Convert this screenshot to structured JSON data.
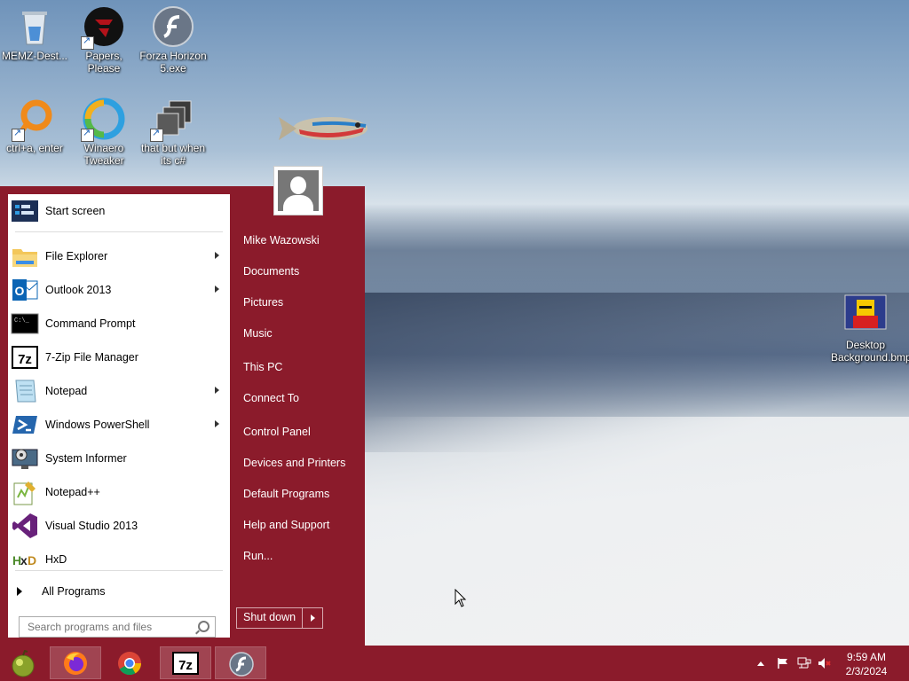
{
  "desktop": {
    "icons": [
      {
        "label": "MEMZ-Dest...",
        "icon": "recycle-bin-icon"
      },
      {
        "label": "Papers, Please",
        "icon": "papers-please-icon"
      },
      {
        "label": "Forza Horizon 5.exe",
        "icon": "flash-icon"
      },
      {
        "label": "ctrl+a, enter",
        "icon": "ring-icon"
      },
      {
        "label": "Winaero Tweaker",
        "icon": "winaero-icon"
      },
      {
        "label": "that but when its c#",
        "icon": "windows-stack-icon"
      },
      {
        "label": "Desktop Background.bmp",
        "icon": "bitmap-image-icon"
      }
    ]
  },
  "start_menu": {
    "pinned": [
      {
        "label": "Start screen",
        "icon": "start-screen-icon",
        "submenu": false
      },
      {
        "label": "File Explorer",
        "icon": "folder-icon",
        "submenu": true
      },
      {
        "label": "Outlook 2013",
        "icon": "outlook-icon",
        "submenu": true
      },
      {
        "label": "Command Prompt",
        "icon": "command-prompt-icon",
        "submenu": false
      },
      {
        "label": "7-Zip File Manager",
        "icon": "seven-zip-icon",
        "submenu": false
      },
      {
        "label": "Notepad",
        "icon": "notepad-icon",
        "submenu": true
      },
      {
        "label": "Windows PowerShell",
        "icon": "powershell-icon",
        "submenu": true
      },
      {
        "label": "System Informer",
        "icon": "system-informer-icon",
        "submenu": false
      },
      {
        "label": "Notepad++",
        "icon": "notepad-plus-plus-icon",
        "submenu": false
      },
      {
        "label": "Visual Studio 2013",
        "icon": "visual-studio-icon",
        "submenu": false
      },
      {
        "label": "HxD",
        "icon": "hxd-icon",
        "submenu": false
      }
    ],
    "all_programs_label": "All Programs",
    "search_placeholder": "Search programs and files",
    "right_items": [
      "Mike Wazowski",
      "Documents",
      "Pictures",
      "Music",
      "This PC",
      "Connect To",
      "Control Panel",
      "Devices and Printers",
      "Default Programs",
      "Help and Support",
      "Run..."
    ],
    "shutdown_label": "Shut down"
  },
  "taskbar": {
    "buttons": [
      "start-orb-icon",
      "firefox-icon",
      "chrome-icon",
      "seven-zip-icon",
      "flash-icon"
    ],
    "clock_time": "9:59 AM",
    "clock_date": "2/3/2024"
  },
  "colors": {
    "accent": "#8b1b2b"
  }
}
